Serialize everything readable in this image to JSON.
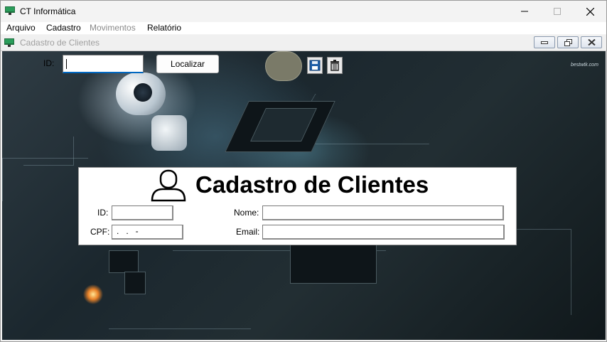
{
  "window": {
    "title": "CT Informática"
  },
  "menu": [
    {
      "label": "Arquivo",
      "enabled": true
    },
    {
      "label": "Cadastro",
      "enabled": true
    },
    {
      "label": "Movimentos",
      "enabled": false
    },
    {
      "label": "Relatório",
      "enabled": true
    }
  ],
  "child_window": {
    "title": "Cadastro de Clientes"
  },
  "search": {
    "id_label": "ID:",
    "id_value": "",
    "button_label": "Localizar"
  },
  "toolbar": {
    "save_icon": "floppy-disk-icon",
    "delete_icon": "trash-icon"
  },
  "background": {
    "watermark": "bestwtk.com"
  },
  "form": {
    "heading": "Cadastro de Clientes",
    "icon": "user-icon",
    "id_label": "ID:",
    "id_value": "",
    "nome_label": "Nome:",
    "nome_value": "",
    "cpf_label": "CPF:",
    "cpf_mask": ".   .   -",
    "email_label": "Email:",
    "email_value": ""
  },
  "colors": {
    "focus_accent": "#0067c0",
    "client_bg": "#1b272e"
  }
}
